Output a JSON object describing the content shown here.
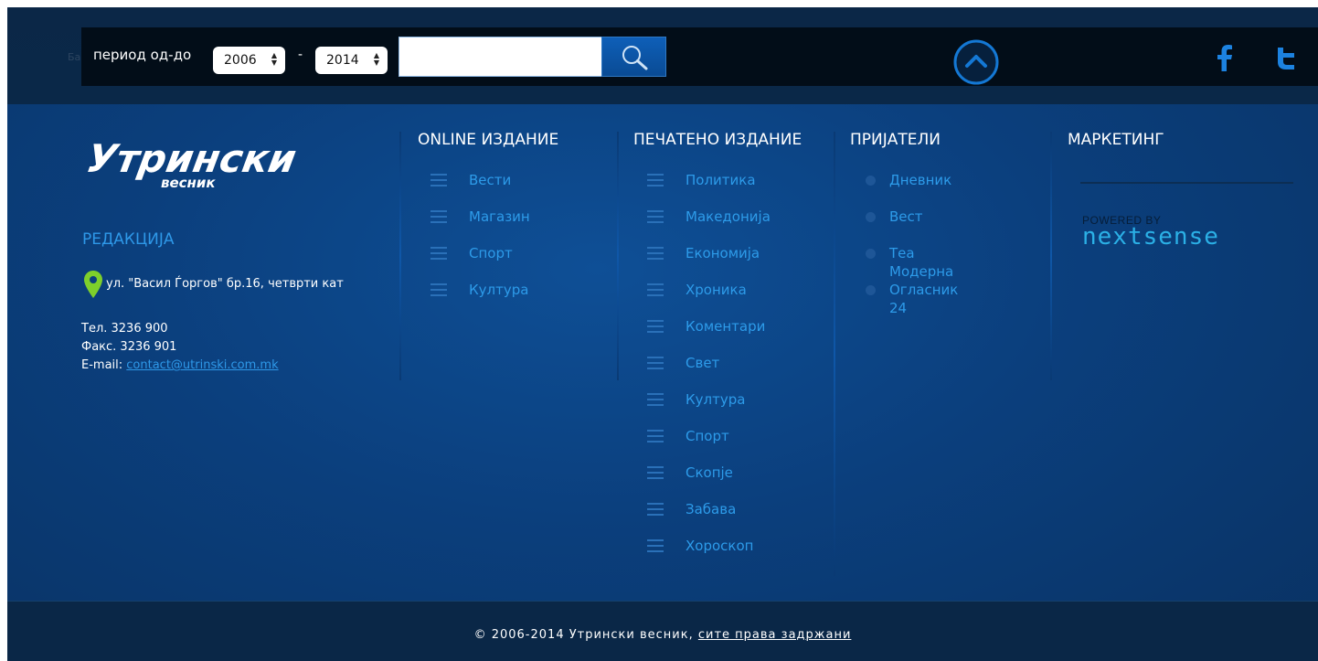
{
  "topbar": {
    "ghost_text": "Ба",
    "period_label": "период од-до",
    "year_from": "2006",
    "year_to": "2014",
    "separator": "-",
    "search_value": "",
    "search_placeholder": ""
  },
  "icons": {
    "search": "search-icon",
    "scroll_top": "chevron-up-circle-icon",
    "facebook": "facebook-icon",
    "twitter": "twitter-icon",
    "location": "map-pin-icon"
  },
  "brand": {
    "logo_main": "Утрински",
    "logo_sub": "весник"
  },
  "redakcija": {
    "title": "РЕДАКЦИЈА",
    "address": "ул. \"Васил Ѓоргов\" бр.16, четврти кат",
    "phone": "Тел. 3236 900",
    "fax": "Факс. 3236 901",
    "email_label": "E-mail: ",
    "email": "contact@utrinski.com.mk"
  },
  "online": {
    "title": "ONLINE ИЗДАНИЕ",
    "items": [
      "Вести",
      "Магазин",
      "Спорт",
      "Култура"
    ]
  },
  "print": {
    "title": "ПЕЧАТЕНО ИЗДАНИЕ",
    "items": [
      "Политика",
      "Македонија",
      "Економија",
      "Хроника",
      "Коментари",
      "Свет",
      "Култура",
      "Спорт",
      "Скопје",
      "Забава",
      "Хороскоп"
    ]
  },
  "friends": {
    "title": "ПРИЈАТЕЛИ",
    "items": [
      "Дневник",
      "Вест",
      "Теа Модерна",
      "Огласник 24"
    ]
  },
  "marketing": {
    "title": "МАРКЕТИНГ",
    "powered_by": "POWERED BY",
    "partner": "nextsense"
  },
  "footer": {
    "copyright": "© 2006-2014 Утрински весник, ",
    "rights": "сите права задржани"
  },
  "colors": {
    "background": "#0b3f7d",
    "link": "#2e98e8",
    "topbar": "#020d18",
    "accent": "#0e5fb8"
  }
}
